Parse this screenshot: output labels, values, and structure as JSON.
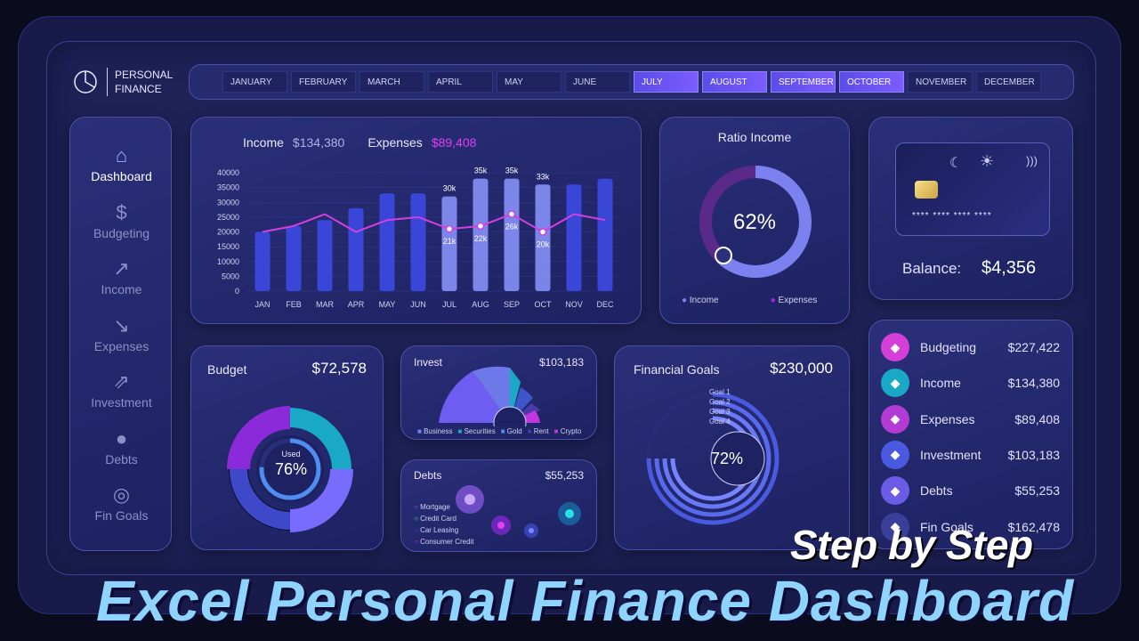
{
  "app": {
    "title_line1": "PERSONAL",
    "title_line2": "FINANCE"
  },
  "months": [
    {
      "label": "JANUARY",
      "active": false
    },
    {
      "label": "FEBRUARY",
      "active": false
    },
    {
      "label": "MARCH",
      "active": false
    },
    {
      "label": "APRIL",
      "active": false
    },
    {
      "label": "MAY",
      "active": false
    },
    {
      "label": "JUNE",
      "active": false
    },
    {
      "label": "JULY",
      "active": true
    },
    {
      "label": "AUGUST",
      "active": true
    },
    {
      "label": "SEPTEMBER",
      "active": true
    },
    {
      "label": "OCTOBER",
      "active": true
    },
    {
      "label": "NOVEMBER",
      "active": false
    },
    {
      "label": "DECEMBER",
      "active": false
    }
  ],
  "sidebar": {
    "items": [
      {
        "label": "Dashboard",
        "icon": "home-icon",
        "active": true
      },
      {
        "label": "Budgeting",
        "icon": "money-bag-icon",
        "active": false
      },
      {
        "label": "Income",
        "icon": "chart-up-icon",
        "active": false
      },
      {
        "label": "Expenses",
        "icon": "chart-down-icon",
        "active": false
      },
      {
        "label": "Investment",
        "icon": "investment-icon",
        "active": false
      },
      {
        "label": "Debts",
        "icon": "piggy-bank-icon",
        "active": false
      },
      {
        "label": "Fin Goals",
        "icon": "target-icon",
        "active": false
      }
    ]
  },
  "summary": {
    "income_label": "Income",
    "income_value": "$134,380",
    "expenses_label": "Expenses",
    "expenses_value": "$89,408"
  },
  "ratio": {
    "title": "Ratio Income",
    "percent": "62%",
    "value": 0.62,
    "legend_income": "Income",
    "legend_expenses": "Expenses"
  },
  "card": {
    "number": "**** **** **** ****",
    "balance_label": "Balance:",
    "balance_value": "$4,356"
  },
  "budget": {
    "title": "Budget",
    "value": "$72,578",
    "used_label": "Used",
    "used_percent": "76%",
    "used": 0.76
  },
  "invest": {
    "title": "Invest",
    "value": "$103,183",
    "legend": [
      "Business",
      "Securities",
      "Gold",
      "Rent",
      "Crypto"
    ]
  },
  "debts": {
    "title": "Debts",
    "value": "$55,253",
    "legend": [
      "Mortgage",
      "Credit Card",
      "Car Leasing",
      "Consumer Credit"
    ]
  },
  "goals": {
    "title": "Financial Goals",
    "value": "$230,000",
    "percent": "72%",
    "labels": [
      "Goal 1",
      "Goal 2",
      "Goal 3",
      "Goal 4"
    ]
  },
  "stats": [
    {
      "name": "Budgeting",
      "value": "$227,422",
      "color": "#d43fd8"
    },
    {
      "name": "Income",
      "value": "$134,380",
      "color": "#1aa8c7"
    },
    {
      "name": "Expenses",
      "value": "$89,408",
      "color": "#b43ad6"
    },
    {
      "name": "Investment",
      "value": "$103,183",
      "color": "#4a5ae0"
    },
    {
      "name": "Debts",
      "value": "$55,253",
      "color": "#6b5ce8"
    },
    {
      "name": "Fin Goals",
      "value": "$162,478",
      "color": "#3a3f9a"
    }
  ],
  "banner": {
    "line1": "Step by Step",
    "line2": "Excel Personal Finance Dashboard"
  },
  "chart_data": {
    "type": "bar",
    "categories": [
      "JAN",
      "FEB",
      "MAR",
      "APR",
      "MAY",
      "JUN",
      "JUL",
      "AUG",
      "SEP",
      "OCT",
      "NOV",
      "DEC"
    ],
    "series": [
      {
        "name": "Income",
        "type": "bar",
        "values": [
          20000,
          22000,
          24000,
          28000,
          33000,
          33000,
          32000,
          38000,
          38000,
          36000,
          36000,
          38000
        ],
        "labels": [
          "",
          "",
          "",
          "",
          "",
          "",
          "30k",
          "35k",
          "35k",
          "33k",
          "",
          ""
        ]
      },
      {
        "name": "Expenses",
        "type": "line",
        "values": [
          20000,
          22000,
          26000,
          20000,
          24000,
          25000,
          21000,
          22000,
          26000,
          20000,
          26000,
          24000
        ],
        "labels": [
          "",
          "",
          "",
          "",
          "",
          "",
          "21k",
          "22k",
          "26k",
          "20k",
          "",
          ""
        ]
      }
    ],
    "yticks": [
      "40000",
      "35000",
      "30000",
      "25000",
      "20000",
      "15000",
      "10000",
      "5000",
      "0"
    ],
    "ylim": [
      0,
      40000
    ]
  }
}
